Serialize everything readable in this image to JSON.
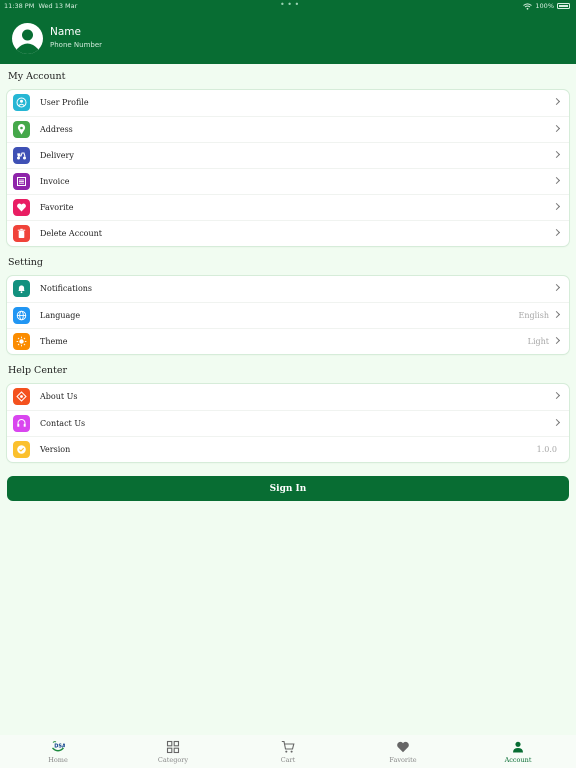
{
  "status_bar": {
    "time": "11:38 PM",
    "date": "Wed 13 Mar",
    "battery": "100%"
  },
  "profile": {
    "name": "Name",
    "phone_label": "Phone Number"
  },
  "sections": {
    "my_account": {
      "title": "My Account",
      "items": [
        {
          "label": "User Profile",
          "icon": "user-profile-icon",
          "color": "#26b6d4"
        },
        {
          "label": "Address",
          "icon": "location-pin-icon",
          "color": "#45a84a"
        },
        {
          "label": "Delivery",
          "icon": "delivery-scooter-icon",
          "color": "#3f51b5"
        },
        {
          "label": "Invoice",
          "icon": "invoice-icon",
          "color": "#8e24aa"
        },
        {
          "label": "Favorite",
          "icon": "heart-icon",
          "color": "#e91e63"
        },
        {
          "label": "Delete Account",
          "icon": "trash-icon",
          "color": "#f0433a"
        }
      ]
    },
    "setting": {
      "title": "Setting",
      "items": [
        {
          "label": "Notifications",
          "icon": "bell-icon",
          "color": "#12917f",
          "value": ""
        },
        {
          "label": "Language",
          "icon": "globe-icon",
          "color": "#2196f3",
          "value": "English"
        },
        {
          "label": "Theme",
          "icon": "sun-icon",
          "color": "#fb8c00",
          "value": "Light"
        }
      ]
    },
    "help_center": {
      "title": "Help Center",
      "items": [
        {
          "label": "About Us",
          "icon": "about-icon",
          "color": "#f4511e",
          "value": ""
        },
        {
          "label": "Contact Us",
          "icon": "contact-icon",
          "color": "#d946ef",
          "value": ""
        },
        {
          "label": "Version",
          "icon": "badge-check-icon",
          "color": "#fbc02d",
          "value": "1.0.0"
        }
      ]
    }
  },
  "sign_in_label": "Sign In",
  "bottom_nav": {
    "items": [
      {
        "label": "Home",
        "icon": "dsa-logo-icon"
      },
      {
        "label": "Category",
        "icon": "grid-icon"
      },
      {
        "label": "Cart",
        "icon": "cart-icon"
      },
      {
        "label": "Favorite",
        "icon": "heart-icon"
      },
      {
        "label": "Account",
        "icon": "person-icon"
      }
    ],
    "active": "Account"
  },
  "colors": {
    "primary": "#086d33",
    "background": "#f1fcf1"
  }
}
